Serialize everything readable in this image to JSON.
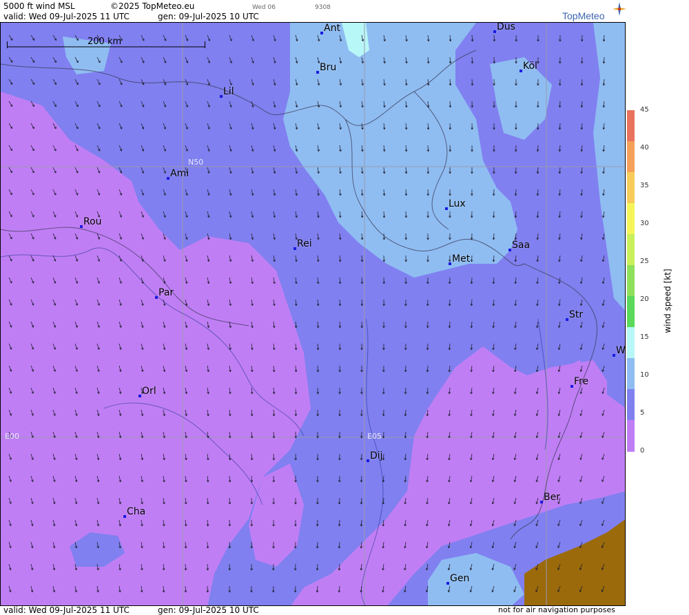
{
  "header": {
    "product": "5000 ft wind MSL",
    "copyright": "©2025 TopMeteo.eu",
    "day_tag": "Wed 06",
    "code": "9308",
    "valid": "valid:  Wed  09-Jul-2025  11 UTC",
    "generated": "gen:  09-Jul-2025 10 UTC"
  },
  "logo": {
    "text": "TopMeteo"
  },
  "scale": {
    "label": "200 km"
  },
  "grid_labels": {
    "n50": "N50",
    "e00": "E00",
    "e05": "E05"
  },
  "cities": [
    {
      "name": "Ant"
    },
    {
      "name": "Düs"
    },
    {
      "name": "Bru"
    },
    {
      "name": "Köl"
    },
    {
      "name": "Lil"
    },
    {
      "name": "Ami"
    },
    {
      "name": "Rou"
    },
    {
      "name": "Lux"
    },
    {
      "name": "Rei"
    },
    {
      "name": "Saa"
    },
    {
      "name": "Met"
    },
    {
      "name": "Par"
    },
    {
      "name": "Str"
    },
    {
      "name": "W"
    },
    {
      "name": "Fre"
    },
    {
      "name": "Orl"
    },
    {
      "name": "Dij"
    },
    {
      "name": "Ber"
    },
    {
      "name": "Cha"
    },
    {
      "name": "Gen"
    }
  ],
  "legend": {
    "title": "wind  speed  [kt]",
    "ticks": [
      "45",
      "40",
      "35",
      "30",
      "25",
      "20",
      "15",
      "10",
      "5",
      "0"
    ],
    "colors": [
      "#e8725d",
      "#f5a15a",
      "#f7cc5a",
      "#f5f55a",
      "#c9ef5a",
      "#8ee05a",
      "#5ad95a",
      "#b8f7f7",
      "#8fbdf2",
      "#8080f0",
      "#c07ef5"
    ]
  },
  "map_colors": {
    "calm": "#c07ef5",
    "light": "#8080f0",
    "moderate": "#8fbdf2",
    "fresh": "#b8f7f7",
    "terrain": "#9b6a0b"
  },
  "footer": {
    "valid": "valid:  Wed  09-Jul-2025  11 UTC",
    "generated": "gen:  09-Jul-2025 10 UTC",
    "disclaimer": "not for air navigation purposes"
  }
}
